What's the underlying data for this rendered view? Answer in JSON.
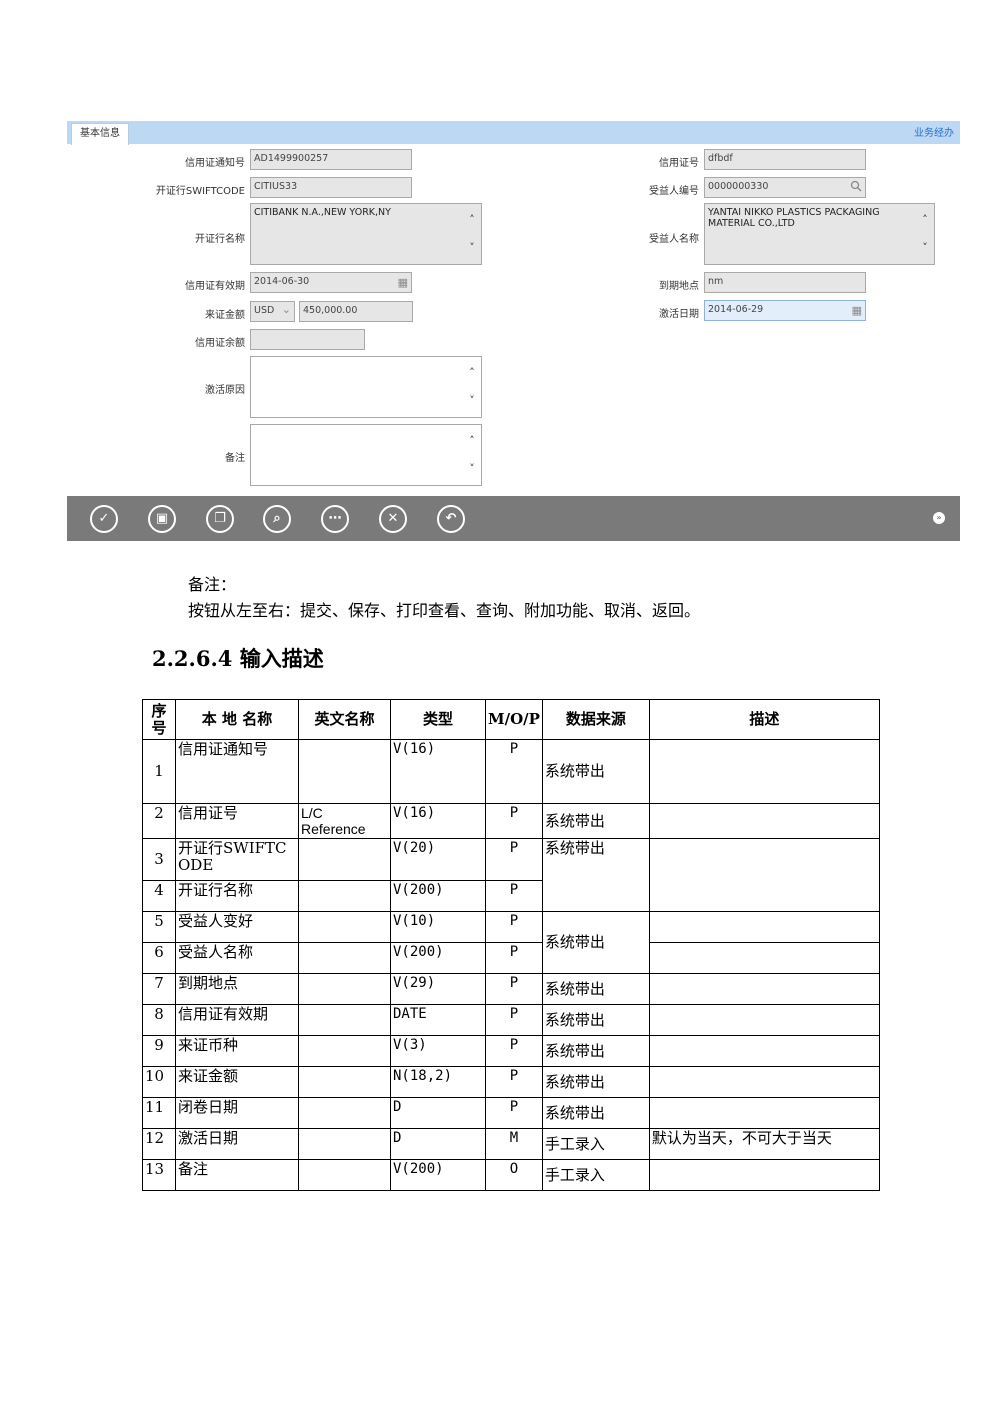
{
  "form": {
    "tab_label": "基本信息",
    "biz_link": "业务经办",
    "left_fields": {
      "notice_no": {
        "label": "信用证通知号",
        "value": "AD1499900257"
      },
      "swift": {
        "label": "开证行SWIFTCODE",
        "value": "CITIUS33"
      },
      "bank_name": {
        "label": "开证行名称",
        "value": "CITIBANK N.A.,NEW YORK,NY"
      },
      "validity": {
        "label": "信用证有效期",
        "value": "2014-06-30"
      },
      "amount": {
        "label": "来证金额",
        "currency": "USD",
        "value": "450,000.00"
      },
      "balance": {
        "label": "信用证余额",
        "value": ""
      },
      "reason": {
        "label": "激活原因",
        "value": ""
      },
      "remark": {
        "label": "备注",
        "value": ""
      }
    },
    "right_fields": {
      "lc_no": {
        "label": "信用证号",
        "value": "dfbdf"
      },
      "beneficiary_no": {
        "label": "受益人编号",
        "value": "0000000330"
      },
      "beneficiary_name": {
        "label": "受益人名称",
        "value": "YANTAI NIKKO PLASTICS PACKAGING MATERIAL CO.,LTD"
      },
      "expiry_place": {
        "label": "到期地点",
        "value": "nm"
      },
      "activate_date": {
        "label": "激活日期",
        "value": "2014-06-29"
      }
    },
    "icons": {
      "scroll_up": "˄",
      "scroll_down": "˅",
      "search": "🔍",
      "calendar": "▦",
      "dropdown": "⌄"
    },
    "toolbar": [
      {
        "name": "submit-button",
        "icon": "✓"
      },
      {
        "name": "save-button",
        "icon": "▣"
      },
      {
        "name": "print-preview-button",
        "icon": "❐"
      },
      {
        "name": "query-button",
        "icon": "⌕"
      },
      {
        "name": "extra-functions-button",
        "icon": "⋯"
      },
      {
        "name": "cancel-button",
        "icon": "✕"
      },
      {
        "name": "back-button",
        "icon": "↶"
      }
    ],
    "next_icon": "»"
  },
  "note": {
    "title": "备注：",
    "text": "按钮从左至右：提交、保存、打印查看、查询、附加功能、取消、返回。"
  },
  "heading": "2.2.6.4 输入描述",
  "table": {
    "headers": {
      "seq": "序号",
      "local": "本 地 名称",
      "english": "英文名称",
      "type": "类型",
      "mop": "M/O/P",
      "source": "数据来源",
      "desc": "描述"
    },
    "rows": [
      {
        "seq": "1",
        "local": "信用证通知号",
        "english": "",
        "type": "V(16)",
        "mop": "P",
        "source": "系统带出",
        "desc": ""
      },
      {
        "seq": "2",
        "local": "信用证号",
        "english": "L/C Reference",
        "type": "V(16)",
        "mop": "P",
        "source": "系统带出",
        "desc": ""
      },
      {
        "seq": "3",
        "local": "开证行SWIFTCODE",
        "english": "",
        "type": "V(20)",
        "mop": "P",
        "source": "系统带出",
        "desc": ""
      },
      {
        "seq": "4",
        "local": "开证行名称",
        "english": "",
        "type": "V(200)",
        "mop": "P",
        "source": "",
        "desc": ""
      },
      {
        "seq": "5",
        "local": "受益人变好",
        "english": "",
        "type": "V(10)",
        "mop": "P",
        "source": "系统带出",
        "desc": ""
      },
      {
        "seq": "6",
        "local": "受益人名称",
        "english": "",
        "type": "V(200)",
        "mop": "P",
        "source": "",
        "desc": ""
      },
      {
        "seq": "7",
        "local": "到期地点",
        "english": "",
        "type": "V(29)",
        "mop": "P",
        "source": "系统带出",
        "desc": ""
      },
      {
        "seq": "8",
        "local": "信用证有效期",
        "english": "",
        "type": "DATE",
        "mop": "P",
        "source": "系统带出",
        "desc": ""
      },
      {
        "seq": "9",
        "local": "来证币种",
        "english": "",
        "type": "V(3)",
        "mop": "P",
        "source": "系统带出",
        "desc": ""
      },
      {
        "seq": "10",
        "local": "来证金额",
        "english": "",
        "type": "N(18,2)",
        "mop": "P",
        "source": "系统带出",
        "desc": ""
      },
      {
        "seq": "11",
        "local": "闭卷日期",
        "english": "",
        "type": "D",
        "mop": "P",
        "source": "系统带出",
        "desc": ""
      },
      {
        "seq": "12",
        "local": "激活日期",
        "english": "",
        "type": "D",
        "mop": "M",
        "source": "手工录入",
        "desc": "默认为当天，不可大于当天"
      },
      {
        "seq": "13",
        "local": "备注",
        "english": "",
        "type": "V(200)",
        "mop": "O",
        "source": "手工录入",
        "desc": ""
      }
    ]
  }
}
